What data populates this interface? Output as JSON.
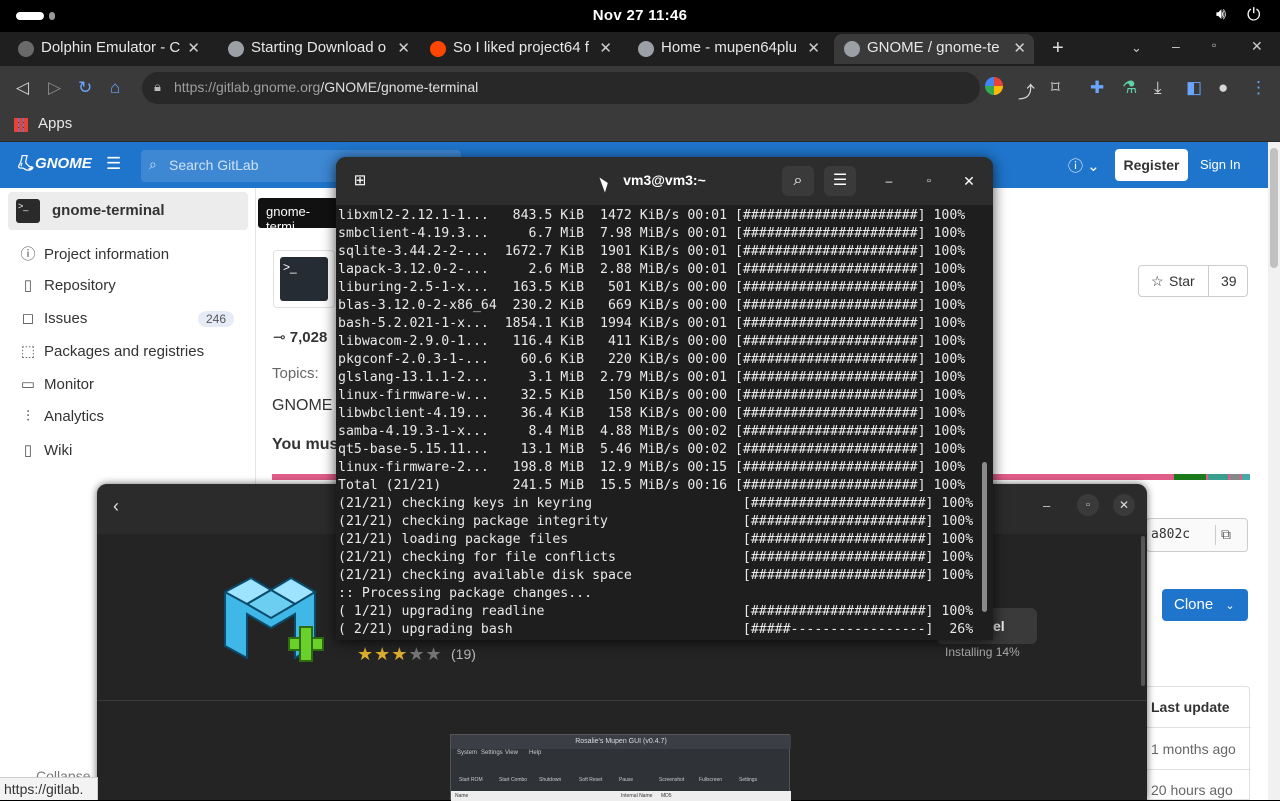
{
  "system": {
    "clock": "Nov 27  11:46"
  },
  "browser": {
    "tabs": [
      {
        "title": "Dolphin Emulator - C",
        "color": "#6a6a6a"
      },
      {
        "title": "Starting Download o",
        "color": "#9aa0a6"
      },
      {
        "title": "So I liked project64 f",
        "color": "#ff4500"
      },
      {
        "title": "Home - mupen64plu",
        "color": "#9aa0a6"
      },
      {
        "title": "GNOME / gnome-te",
        "color": "#9aa0a6"
      }
    ],
    "url_host": "https://gitlab.gnome.org",
    "url_path": "/GNOME/gnome-terminal",
    "bookmarks_label": "Apps"
  },
  "gitlab": {
    "logo_text": "GNOME",
    "search_placeholder": "Search GitLab",
    "register": "Register",
    "signin": "Sign In",
    "project_name": "gnome-terminal",
    "tooltip": "gnome-termi",
    "nav": [
      {
        "label": "Project information",
        "icon": "info-icon",
        "glyph": "ⓘ"
      },
      {
        "label": "Repository",
        "icon": "doc-icon",
        "glyph": "▯"
      },
      {
        "label": "Issues",
        "icon": "issues-icon",
        "glyph": "◻",
        "badge": "246"
      },
      {
        "label": "Packages and registries",
        "icon": "package-icon",
        "glyph": "⬚"
      },
      {
        "label": "Monitor",
        "icon": "monitor-icon",
        "glyph": "▭"
      },
      {
        "label": "Analytics",
        "icon": "chart-icon",
        "glyph": "⫶"
      },
      {
        "label": "Wiki",
        "icon": "book-icon",
        "glyph": "▯"
      }
    ],
    "commits": "7,028",
    "topics_label": "Topics:",
    "gnome_tag": "GNOME",
    "must_text": "You mus",
    "star_label": "Star",
    "star_count": "39",
    "sha_fragment": "a802c",
    "clone_label": "Clone",
    "last_update_header": "Last update",
    "row1_update": "1 months ago",
    "row2_update": "20 hours ago",
    "collapse_label": "Collapse"
  },
  "status_url": "https://gitlab.",
  "software": {
    "rating_count": "(19)",
    "rating": 3,
    "progress_label": "Installing 14%",
    "cancel_fragment": "el",
    "screenshot": {
      "title": "Rosalie's Mupen GUI (v0.4.7)",
      "menus": [
        "System",
        "Settings",
        "View",
        "Help"
      ],
      "tools": [
        "Start ROM",
        "Start Combo",
        "Shutdown",
        "Soft Reset",
        "Pause",
        "Screenshot",
        "Fullscreen",
        "Settings"
      ],
      "cols": [
        "Name",
        "Internal Name",
        "MD5"
      ]
    }
  },
  "terminal": {
    "title": "vm3@vm3:~",
    "lines": [
      "libxml2-2.12.1-1...   843.5 KiB  1472 KiB/s 00:01 [######################] 100%",
      "smbclient-4.19.3...     6.7 MiB  7.98 MiB/s 00:01 [######################] 100%",
      "sqlite-3.44.2-2-...  1672.7 KiB  1901 KiB/s 00:01 [######################] 100%",
      "lapack-3.12.0-2-...     2.6 MiB  2.88 MiB/s 00:01 [######################] 100%",
      "liburing-2.5-1-x...   163.5 KiB   501 KiB/s 00:00 [######################] 100%",
      "blas-3.12.0-2-x86_64  230.2 KiB   669 KiB/s 00:00 [######################] 100%",
      "bash-5.2.021-1-x...  1854.1 KiB  1994 KiB/s 00:01 [######################] 100%",
      "libwacom-2.9.0-1...   116.4 KiB   411 KiB/s 00:00 [######################] 100%",
      "pkgconf-2.0.3-1-...    60.6 KiB   220 KiB/s 00:00 [######################] 100%",
      "glslang-13.1.1-2...     3.1 MiB  2.79 MiB/s 00:01 [######################] 100%",
      "linux-firmware-w...    32.5 KiB   150 KiB/s 00:00 [######################] 100%",
      "libwbclient-4.19...    36.4 KiB   158 KiB/s 00:00 [######################] 100%",
      "samba-4.19.3-1-x...     8.4 MiB  4.88 MiB/s 00:02 [######################] 100%",
      "qt5-base-5.15.11...    13.1 MiB  5.46 MiB/s 00:02 [######################] 100%",
      "linux-firmware-2...   198.8 MiB  12.9 MiB/s 00:15 [######################] 100%",
      "Total (21/21)         241.5 MiB  15.5 MiB/s 00:16 [######################] 100%",
      "(21/21) checking keys in keyring                   [######################] 100%",
      "(21/21) checking package integrity                 [######################] 100%",
      "(21/21) loading package files                      [######################] 100%",
      "(21/21) checking for file conflicts                [######################] 100%",
      "(21/21) checking available disk space              [######################] 100%",
      ":: Processing package changes...",
      "( 1/21) upgrading readline                         [######################] 100%",
      "( 2/21) upgrading bash                             [#####-----------------]  26%"
    ]
  }
}
